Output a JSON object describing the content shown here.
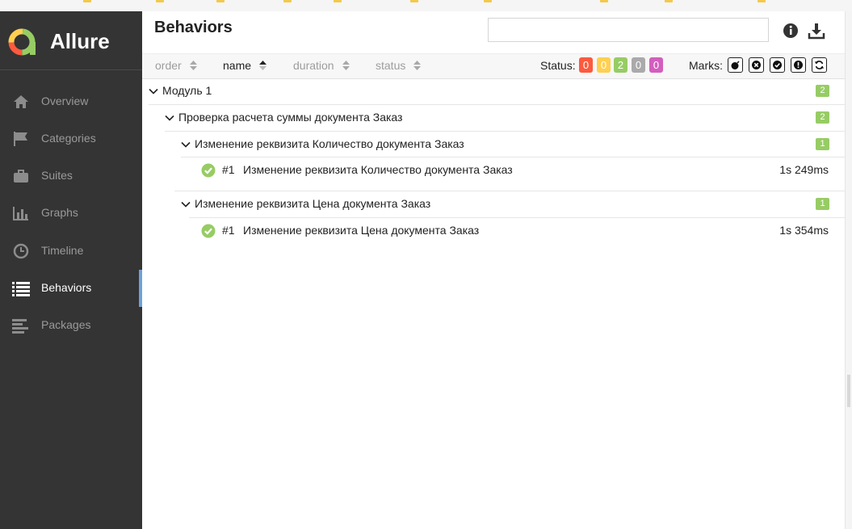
{
  "app": {
    "name": "Allure"
  },
  "sidebar": {
    "items": [
      {
        "label": "Overview",
        "icon": "home-icon"
      },
      {
        "label": "Categories",
        "icon": "flag-icon"
      },
      {
        "label": "Suites",
        "icon": "briefcase-icon"
      },
      {
        "label": "Graphs",
        "icon": "bar-chart-icon"
      },
      {
        "label": "Timeline",
        "icon": "clock-icon"
      },
      {
        "label": "Behaviors",
        "icon": "list-icon",
        "active": true
      },
      {
        "label": "Packages",
        "icon": "align-left-icon"
      }
    ]
  },
  "header": {
    "title": "Behaviors",
    "search_placeholder": ""
  },
  "toolbar": {
    "sort": [
      {
        "label": "order"
      },
      {
        "label": "name",
        "active": true
      },
      {
        "label": "duration"
      },
      {
        "label": "status"
      }
    ],
    "status_label": "Status:",
    "status_counts": [
      {
        "status": "failed",
        "value": "0",
        "color": "#fd5a3e"
      },
      {
        "status": "broken",
        "value": "0",
        "color": "#ffd050"
      },
      {
        "status": "passed",
        "value": "2",
        "color": "#97cc64"
      },
      {
        "status": "skipped",
        "value": "0",
        "color": "#aaaaaa"
      },
      {
        "status": "unknown",
        "value": "0",
        "color": "#d35ebe"
      }
    ],
    "marks_label": "Marks:"
  },
  "tree": {
    "feature": {
      "name": "Модуль 1",
      "count": "2"
    },
    "story": {
      "name": "Проверка расчета суммы документа Заказ",
      "count": "2"
    },
    "groups": [
      {
        "name": "Изменение реквизита Количество документа Заказ",
        "count": "1",
        "test": {
          "num": "#1",
          "name": "Изменение реквизита Количество документа Заказ",
          "duration": "1s 249ms"
        }
      },
      {
        "name": "Изменение реквизита Цена документа Заказ",
        "count": "1",
        "test": {
          "num": "#1",
          "name": "Изменение реквизита Цена документа Заказ",
          "duration": "1s 354ms"
        }
      }
    ]
  }
}
